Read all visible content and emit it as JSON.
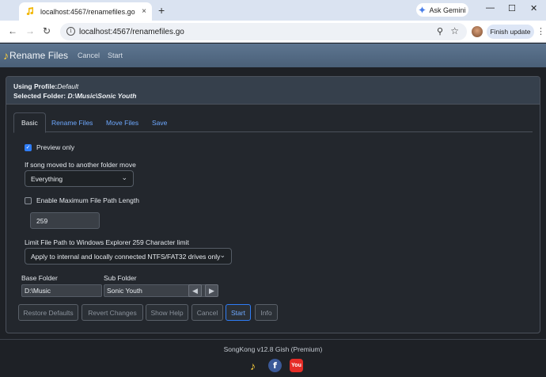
{
  "browser": {
    "tab_title": "localhost:4567/renamefiles.go",
    "tab_close": "×",
    "new_tab": "+",
    "gemini_label": "Ask Gemini",
    "url": "localhost:4567/renamefiles.go",
    "finish_update": "Finish update",
    "window_min": "—",
    "window_max": "☐",
    "window_close": "✕"
  },
  "app": {
    "brand": "Rename Files",
    "nav": [
      "Cancel",
      "Start"
    ]
  },
  "panel": {
    "profile_label": "Using Profile:",
    "profile_value": "Default",
    "folder_label": "Selected Folder: ",
    "folder_value": "D:\\Music\\Sonic Youth",
    "tabs": [
      "Basic",
      "Rename Files",
      "Move Files",
      "Save"
    ],
    "active_tab": "Basic"
  },
  "form": {
    "preview_only": {
      "label": "Preview only",
      "checked": true
    },
    "moved_label": "If song moved to another folder move",
    "moved_value": "Everything",
    "max_path": {
      "label": "Enable Maximum File Path Length",
      "checked": false
    },
    "max_path_value": "259",
    "limit_label": "Limit File Path to Windows Explorer 259 Character limit",
    "limit_value": "Apply to internal and locally connected NTFS/FAT32 drives only",
    "base_folder_label": "Base Folder",
    "base_folder_value": "D:\\Music",
    "sub_folder_label": "Sub Folder",
    "sub_folder_value": "Sonic Youth"
  },
  "buttons": {
    "restore": "Restore Defaults",
    "revert": "Revert Changes",
    "help": "Show Help",
    "cancel": "Cancel",
    "start": "Start",
    "info": "Info"
  },
  "footer": {
    "version": "SongKong v12.8 Gish (Premium)",
    "facebook_glyph": "f",
    "youtube_glyph": "You"
  },
  "colors": {
    "app_bar": "#4a6078",
    "accent": "#2f7df6",
    "link": "#6ea8fe",
    "background": "#23272d"
  }
}
